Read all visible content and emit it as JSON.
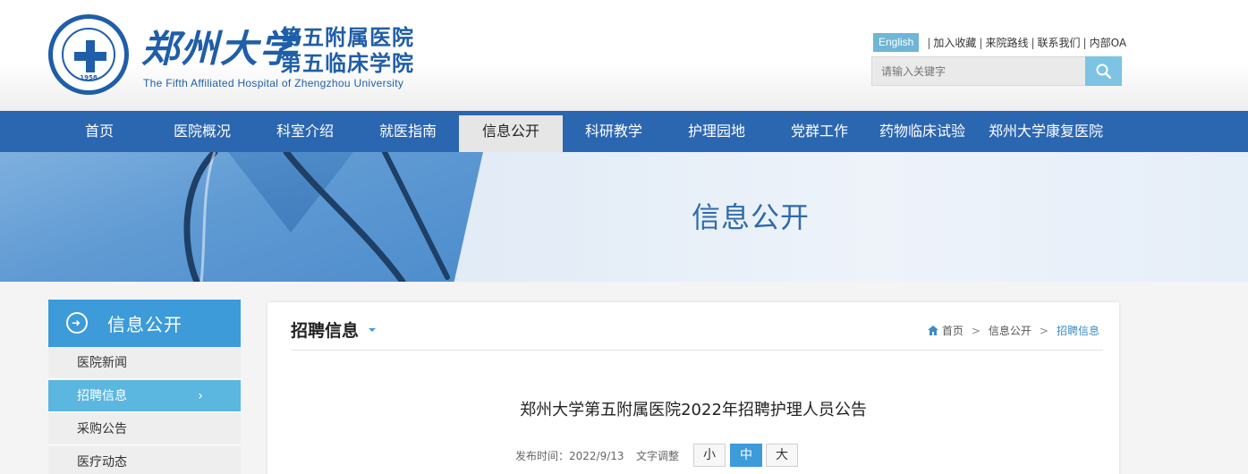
{
  "header": {
    "university_name": "郑州大学",
    "hospital_line1": "第五附属医院",
    "hospital_line2": "第五临床学院",
    "hospital_en": "The Fifth Affiliated Hospital of Zhengzhou University",
    "logo_year": "1958",
    "links": {
      "english": "English",
      "favorite": "加入收藏",
      "route": "来院路线",
      "contact": "联系我们",
      "oa": "内部OA"
    },
    "search": {
      "placeholder": "请输入关键字",
      "icon": "search-icon"
    }
  },
  "nav": {
    "items": [
      {
        "label": "首页"
      },
      {
        "label": "医院概况"
      },
      {
        "label": "科室介绍"
      },
      {
        "label": "就医指南"
      },
      {
        "label": "信息公开"
      },
      {
        "label": "科研教学"
      },
      {
        "label": "护理园地"
      },
      {
        "label": "党群工作"
      },
      {
        "label": "药物临床试验"
      },
      {
        "label": "郑州大学康复医院"
      }
    ],
    "active_index": 4
  },
  "banner": {
    "title": "信息公开"
  },
  "sidebar": {
    "title": "信息公开",
    "icon": "arrow-circle-icon",
    "items": [
      {
        "label": "医院新闻"
      },
      {
        "label": "招聘信息"
      },
      {
        "label": "采购公告"
      },
      {
        "label": "医疗动态"
      }
    ],
    "active_index": 1
  },
  "content": {
    "section_title": "招聘信息",
    "breadcrumb": {
      "home": "首页",
      "parent": "信息公开",
      "current": "招聘信息",
      "separator": ">"
    },
    "article_title": "郑州大学第五附属医院2022年招聘护理人员公告",
    "publish_label": "发布时间：2022/9/13",
    "font_adjust_label": "文字调整",
    "font_sizes": {
      "small": "小",
      "medium": "中",
      "large": "大"
    },
    "font_active": "medium"
  },
  "colors": {
    "nav_blue": "#2b66b0",
    "accent_blue": "#3c9bd8",
    "sidebar_active": "#5bb6e0"
  }
}
